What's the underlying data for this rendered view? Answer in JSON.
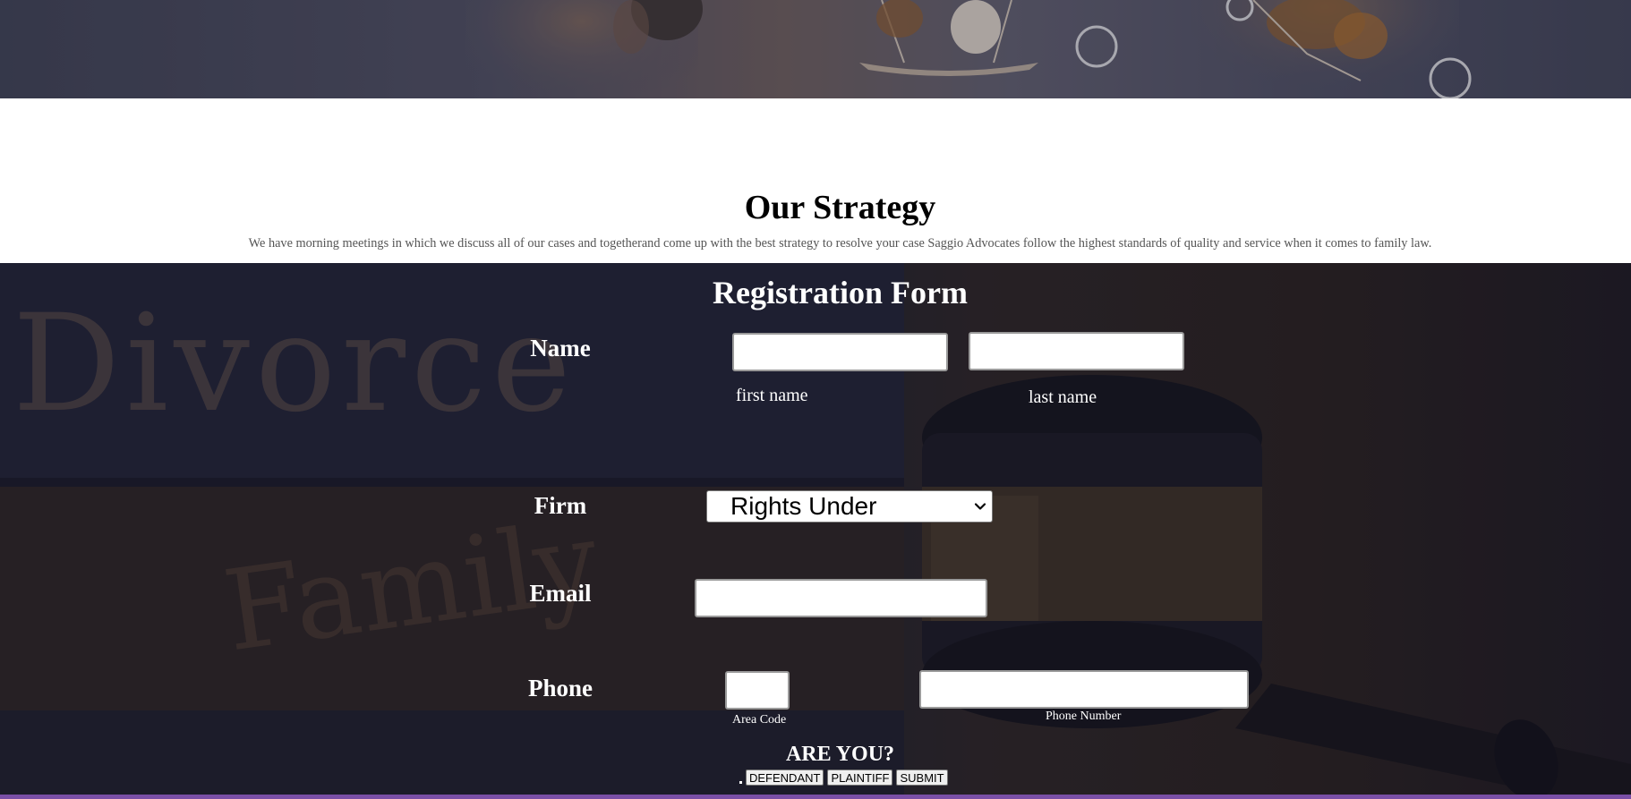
{
  "strategy": {
    "title": "Our Strategy",
    "text": "We have morning meetings in which we discuss all of our cases and togetherand come up with the best strategy to resolve your case Saggio Advocates follow the highest standards of quality and service when it comes to family law."
  },
  "background_words": {
    "divorce": "Divorce",
    "family": "Family"
  },
  "form": {
    "title": "Registration Form",
    "name": {
      "label": "Name",
      "first_hint": "first name",
      "last_hint": "last name",
      "first_value": "",
      "last_value": ""
    },
    "firm": {
      "label": "Firm",
      "selected": "Rights Under"
    },
    "email": {
      "label": "Email",
      "value": ""
    },
    "phone": {
      "label": "Phone",
      "area_hint": "Area Code",
      "number_hint": "Phone Number",
      "area_value": "",
      "number_value": ""
    },
    "are_you": "ARE YOU?",
    "buttons": {
      "defendant": "DEFENDANT",
      "plaintiff": "PLAINTIFF",
      "submit": "SUBMIT"
    }
  },
  "colors": {
    "accent_bar": "#7a4fa6",
    "overlay_dark": "#1e1e30",
    "text_light": "#ffffff"
  },
  "icons": {
    "select_arrow": "chevron-down-icon"
  }
}
